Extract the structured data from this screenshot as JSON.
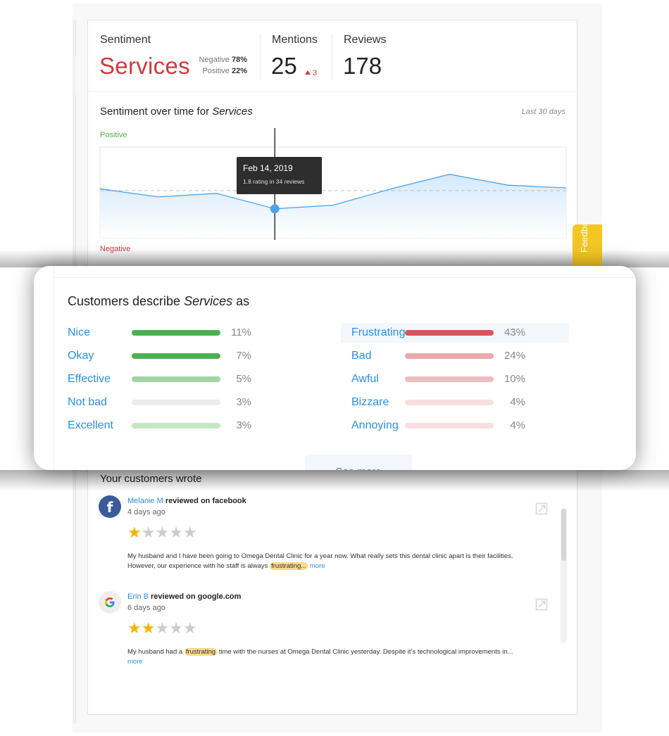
{
  "header": {
    "sentiment_label": "Sentiment",
    "sentiment_topic": "Services",
    "negative_label": "Negative",
    "negative_pct": "78%",
    "positive_label": "Positive",
    "positive_pct": "22%",
    "mentions_label": "Mentions",
    "mentions_value": "25",
    "mentions_delta": "3",
    "reviews_label": "Reviews",
    "reviews_value": "178"
  },
  "chart": {
    "title_prefix": "Sentiment over time for ",
    "title_topic": "Services",
    "range_label": "Last 30 days",
    "top_label": "Positive",
    "bottom_label": "Negative",
    "tooltip_date": "Feb 14, 2019",
    "tooltip_detail": "1.8 rating in 34 reviews",
    "colors": {
      "line": "#4aa3ee",
      "fill": "#dcedfc",
      "marker": "#4aa3ee",
      "positive": "#4caf50",
      "negative": "#d0393b"
    }
  },
  "chart_data": {
    "type": "area",
    "title": "Sentiment over time for Services",
    "subtitle": "Last 30 days",
    "xlabel": "",
    "ylabel": "",
    "y_top_label": "Positive",
    "y_bottom_label": "Negative",
    "series": [
      {
        "name": "Sentiment",
        "values": [
          0.46,
          0.55,
          0.51,
          0.68,
          0.64,
          0.46,
          0.3,
          0.42,
          0.45
        ]
      }
    ],
    "value_scale": "fraction of chart height from top (0 = most positive, 1 = most negative)",
    "baseline": 0.48,
    "highlighted_index": 3,
    "highlighted_point": {
      "date": "Feb 14, 2019",
      "rating": 1.8,
      "reviews": 34
    },
    "grid": false,
    "legend": "none"
  },
  "describe": {
    "title_prefix": "Customers describe ",
    "title_topic": "Services",
    "title_suffix": " as",
    "positive": [
      {
        "word": "Nice",
        "pct": "11%",
        "color": "#4caf50"
      },
      {
        "word": "Okay",
        "pct": "7%",
        "color": "#4caf50"
      },
      {
        "word": "Effective",
        "pct": "5%",
        "color": "#a3d3a4"
      },
      {
        "word": "Not bad",
        "pct": "3%",
        "color": "#ebebeb"
      },
      {
        "word": "Excellent",
        "pct": "3%",
        "color": "#c4e6c5"
      }
    ],
    "negative": [
      {
        "word": "Frustrating",
        "pct": "43%",
        "color": "#d0585a",
        "highlighted": true
      },
      {
        "word": "Bad",
        "pct": "24%",
        "color": "#e8a9aa"
      },
      {
        "word": "Awful",
        "pct": "10%",
        "color": "#edbdbe"
      },
      {
        "word": "Bizzare",
        "pct": "4%",
        "color": "#f7dfe0"
      },
      {
        "word": "Annoying",
        "pct": "4%",
        "color": "#f7dfe0"
      }
    ],
    "see_more": "See more"
  },
  "feedback_tab": {
    "label": "Feedback"
  },
  "reviews": {
    "title": "Your customers wrote",
    "items": [
      {
        "author": "Melanie M",
        "action": "reviewed on facebook",
        "time": "4 days ago",
        "source_icon": "facebook-icon",
        "rating": 1,
        "max_rating": 5,
        "text_before": "My husband and I have been going to Omega Dental Clinic for a year now. What really sets this dental clinic apart is their facilities. However, our experience with he staff is always ",
        "highlight": "frustrating...",
        "text_after": " ",
        "more": "more"
      },
      {
        "author": "Erin B",
        "action": "reviewed on google.com",
        "time": "6 days ago",
        "source_icon": "google-icon",
        "rating": 2,
        "max_rating": 5,
        "text_before": "My husband had a ",
        "highlight": "frustrating",
        "text_after": " time with the nurses at Omega Dental Clinic yesterday. Despite it’s technological improvements in... ",
        "more": "more"
      }
    ]
  }
}
